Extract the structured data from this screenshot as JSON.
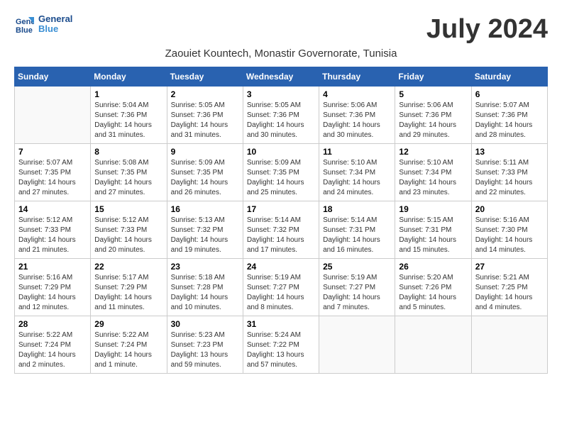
{
  "header": {
    "logo_line1": "General",
    "logo_line2": "Blue",
    "month_title": "July 2024",
    "location": "Zaouiet Kountech, Monastir Governorate, Tunisia"
  },
  "weekdays": [
    "Sunday",
    "Monday",
    "Tuesday",
    "Wednesday",
    "Thursday",
    "Friday",
    "Saturday"
  ],
  "weeks": [
    [
      {
        "day": "",
        "empty": true
      },
      {
        "day": "1",
        "sunrise": "5:04 AM",
        "sunset": "7:36 PM",
        "daylight": "14 hours and 31 minutes."
      },
      {
        "day": "2",
        "sunrise": "5:05 AM",
        "sunset": "7:36 PM",
        "daylight": "14 hours and 31 minutes."
      },
      {
        "day": "3",
        "sunrise": "5:05 AM",
        "sunset": "7:36 PM",
        "daylight": "14 hours and 30 minutes."
      },
      {
        "day": "4",
        "sunrise": "5:06 AM",
        "sunset": "7:36 PM",
        "daylight": "14 hours and 30 minutes."
      },
      {
        "day": "5",
        "sunrise": "5:06 AM",
        "sunset": "7:36 PM",
        "daylight": "14 hours and 29 minutes."
      },
      {
        "day": "6",
        "sunrise": "5:07 AM",
        "sunset": "7:36 PM",
        "daylight": "14 hours and 28 minutes."
      }
    ],
    [
      {
        "day": "7",
        "sunrise": "5:07 AM",
        "sunset": "7:35 PM",
        "daylight": "14 hours and 27 minutes."
      },
      {
        "day": "8",
        "sunrise": "5:08 AM",
        "sunset": "7:35 PM",
        "daylight": "14 hours and 27 minutes."
      },
      {
        "day": "9",
        "sunrise": "5:09 AM",
        "sunset": "7:35 PM",
        "daylight": "14 hours and 26 minutes."
      },
      {
        "day": "10",
        "sunrise": "5:09 AM",
        "sunset": "7:35 PM",
        "daylight": "14 hours and 25 minutes."
      },
      {
        "day": "11",
        "sunrise": "5:10 AM",
        "sunset": "7:34 PM",
        "daylight": "14 hours and 24 minutes."
      },
      {
        "day": "12",
        "sunrise": "5:10 AM",
        "sunset": "7:34 PM",
        "daylight": "14 hours and 23 minutes."
      },
      {
        "day": "13",
        "sunrise": "5:11 AM",
        "sunset": "7:33 PM",
        "daylight": "14 hours and 22 minutes."
      }
    ],
    [
      {
        "day": "14",
        "sunrise": "5:12 AM",
        "sunset": "7:33 PM",
        "daylight": "14 hours and 21 minutes."
      },
      {
        "day": "15",
        "sunrise": "5:12 AM",
        "sunset": "7:33 PM",
        "daylight": "14 hours and 20 minutes."
      },
      {
        "day": "16",
        "sunrise": "5:13 AM",
        "sunset": "7:32 PM",
        "daylight": "14 hours and 19 minutes."
      },
      {
        "day": "17",
        "sunrise": "5:14 AM",
        "sunset": "7:32 PM",
        "daylight": "14 hours and 17 minutes."
      },
      {
        "day": "18",
        "sunrise": "5:14 AM",
        "sunset": "7:31 PM",
        "daylight": "14 hours and 16 minutes."
      },
      {
        "day": "19",
        "sunrise": "5:15 AM",
        "sunset": "7:31 PM",
        "daylight": "14 hours and 15 minutes."
      },
      {
        "day": "20",
        "sunrise": "5:16 AM",
        "sunset": "7:30 PM",
        "daylight": "14 hours and 14 minutes."
      }
    ],
    [
      {
        "day": "21",
        "sunrise": "5:16 AM",
        "sunset": "7:29 PM",
        "daylight": "14 hours and 12 minutes."
      },
      {
        "day": "22",
        "sunrise": "5:17 AM",
        "sunset": "7:29 PM",
        "daylight": "14 hours and 11 minutes."
      },
      {
        "day": "23",
        "sunrise": "5:18 AM",
        "sunset": "7:28 PM",
        "daylight": "14 hours and 10 minutes."
      },
      {
        "day": "24",
        "sunrise": "5:19 AM",
        "sunset": "7:27 PM",
        "daylight": "14 hours and 8 minutes."
      },
      {
        "day": "25",
        "sunrise": "5:19 AM",
        "sunset": "7:27 PM",
        "daylight": "14 hours and 7 minutes."
      },
      {
        "day": "26",
        "sunrise": "5:20 AM",
        "sunset": "7:26 PM",
        "daylight": "14 hours and 5 minutes."
      },
      {
        "day": "27",
        "sunrise": "5:21 AM",
        "sunset": "7:25 PM",
        "daylight": "14 hours and 4 minutes."
      }
    ],
    [
      {
        "day": "28",
        "sunrise": "5:22 AM",
        "sunset": "7:24 PM",
        "daylight": "14 hours and 2 minutes."
      },
      {
        "day": "29",
        "sunrise": "5:22 AM",
        "sunset": "7:24 PM",
        "daylight": "14 hours and 1 minute."
      },
      {
        "day": "30",
        "sunrise": "5:23 AM",
        "sunset": "7:23 PM",
        "daylight": "13 hours and 59 minutes."
      },
      {
        "day": "31",
        "sunrise": "5:24 AM",
        "sunset": "7:22 PM",
        "daylight": "13 hours and 57 minutes."
      },
      {
        "day": "",
        "empty": true
      },
      {
        "day": "",
        "empty": true
      },
      {
        "day": "",
        "empty": true
      }
    ]
  ]
}
